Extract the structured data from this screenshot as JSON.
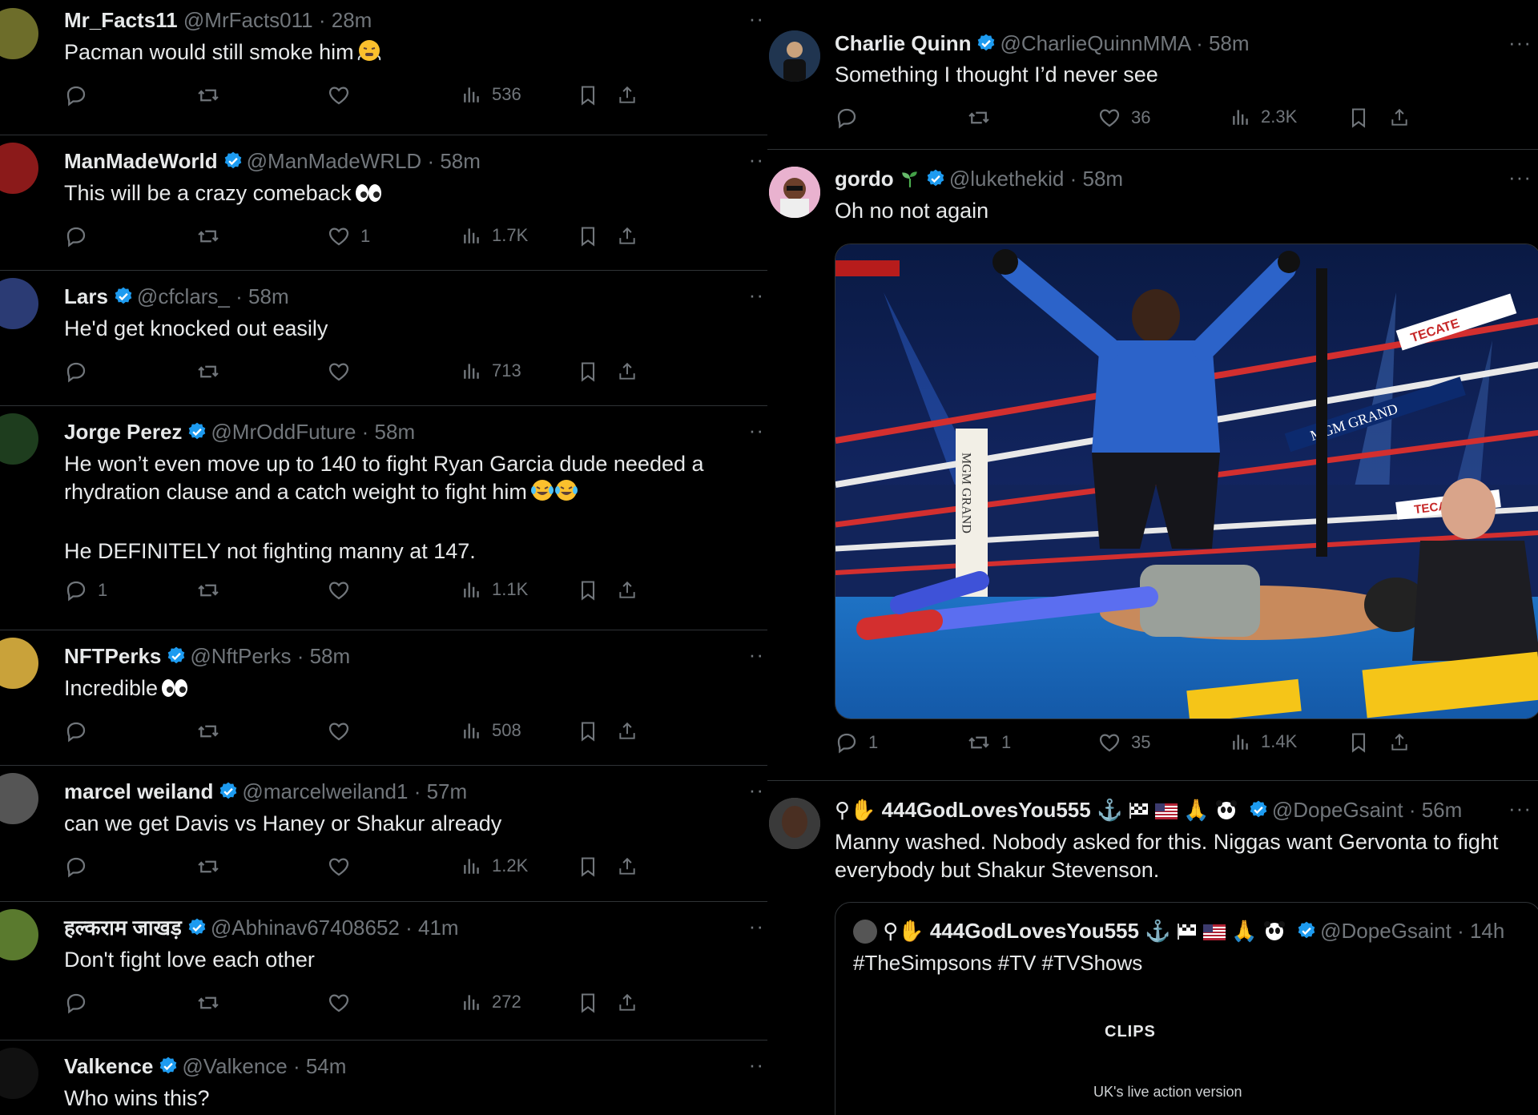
{
  "left_column": [
    {
      "name": "Mr_Facts11",
      "handle": "@MrFacts011",
      "time": "· 28m",
      "verified": false,
      "text": "Pacman would still smoke him",
      "text_emoji": "face-with-steam-from-nose",
      "replies": "",
      "reposts": "",
      "likes": "",
      "views": "536"
    },
    {
      "name": "ManMadeWorld",
      "handle": "@ManMadeWRLD",
      "time": "· 58m",
      "verified": true,
      "text": "This will be a crazy comeback",
      "text_emoji": "eyes",
      "replies": "",
      "reposts": "",
      "likes": "1",
      "views": "1.7K"
    },
    {
      "name": "Lars",
      "handle": "@cfclars_",
      "time": "· 58m",
      "verified": true,
      "text": "He'd get knocked out easily",
      "replies": "",
      "reposts": "",
      "likes": "",
      "views": "713"
    },
    {
      "name": "Jorge Perez",
      "handle": "@MrOddFuture",
      "time": "· 58m",
      "verified": true,
      "text": "He won’t even move up to 140 to fight Ryan Garcia dude needed a\nrhydration clause and a catch weight to fight him",
      "text2": "He DEFINITELY not fighting manny at 147.",
      "text_emoji": "face-with-tears-of-joy",
      "replies": "1",
      "reposts": "",
      "likes": "",
      "views": "1.1K"
    },
    {
      "name": "NFTPerks",
      "handle": "@NftPerks",
      "time": "· 58m",
      "verified": true,
      "text": "Incredible",
      "text_emoji": "eyes",
      "replies": "",
      "reposts": "",
      "likes": "",
      "views": "508"
    },
    {
      "name": "marcel weiland",
      "handle": "@marcelweiland1",
      "time": "· 57m",
      "verified": true,
      "text": "can we get Davis vs Haney or Shakur already",
      "replies": "",
      "reposts": "",
      "likes": "",
      "views": "1.2K"
    },
    {
      "name": "हल्कराम जाखड़",
      "handle": "@Abhinav67408652",
      "time": "· 41m",
      "verified": true,
      "text": "Don't fight love each other",
      "replies": "",
      "reposts": "",
      "likes": "",
      "views": "272"
    },
    {
      "name": "Valkence",
      "handle": "@Valkence",
      "time": "· 54m",
      "verified": true,
      "text": "Who wins this?"
    }
  ],
  "right_column": {
    "charlie": {
      "name": "Charlie Quinn",
      "handle": "@CharlieQuinnMMA",
      "time": "· 58m",
      "text": "Something I thought I’d never see",
      "replies": "",
      "reposts": "",
      "likes": "36",
      "views": "2.3K"
    },
    "gordo": {
      "name": "gordo",
      "handle": "@lukethekid",
      "time": "· 58m",
      "text": "Oh no not again",
      "replies": "1",
      "reposts": "1",
      "likes": "35",
      "views": "1.4K",
      "photo_signs": {
        "mgm_grand_banner": "MGM GRAND",
        "vertical_sign": "MGM GRAND",
        "tecate_1": "TECATE",
        "tecate_2": "TECATE"
      }
    },
    "dope": {
      "name": "444GodLovesYou555",
      "handle": "@DopeGsaint",
      "time": "· 56m",
      "text": "Manny washed. Nobody asked for this. Niggas want Gervonta to fight\neverybody but Shakur Stevenson.",
      "quote": {
        "name": "444GodLovesYou555",
        "handle": "@DopeGsaint",
        "time": "· 14h",
        "text": "#TheSimpsons #TV #TVShows",
        "brand": "CLIPS",
        "caption": "UK's live action version"
      }
    }
  },
  "colors": {
    "background": "#000000",
    "text": "#e7e9ea",
    "muted": "#71767b",
    "verified": "#1d9bf0",
    "divider": "#2f3336"
  },
  "icons": [
    "reply-icon",
    "repost-icon",
    "like-icon",
    "views-icon",
    "bookmark-icon",
    "share-icon",
    "more-icon",
    "verified-badge-icon"
  ]
}
